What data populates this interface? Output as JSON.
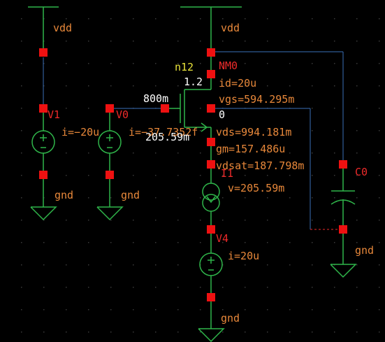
{
  "colors": {
    "background": "#000000",
    "grid_dot": "#3a3a3a",
    "wire": "#3a6fb8",
    "component": "#2fb54a",
    "pin": "#ee1111",
    "label_red": "#ee2a2a",
    "label_orange": "#e8883a",
    "label_yellow": "#e8e23a",
    "label_white": "#ffffff"
  },
  "supply": {
    "left": "vdd",
    "mid": "vdd"
  },
  "V1": {
    "name": "V1",
    "current": "i=−20u",
    "ground": "gnd"
  },
  "V0": {
    "name": "V0",
    "current": "i=−37.7352f",
    "gate_voltage": "800m",
    "ground": "gnd"
  },
  "NM0": {
    "name": "NM0",
    "model": "n12",
    "width": "1.2",
    "id": "id=20u",
    "vgs": "vgs=594.295m",
    "bulk": "0",
    "vds": "vds=994.181m",
    "gm": "gm=157.486u",
    "vdsat": "vdsat=187.798m",
    "source_voltage": "205.59m"
  },
  "I1": {
    "name": "I1",
    "voltage": "v=205.59m"
  },
  "V4": {
    "name": "V4",
    "current": "i=20u",
    "ground": "gnd"
  },
  "C0": {
    "name": "C0",
    "ground": "gnd"
  }
}
